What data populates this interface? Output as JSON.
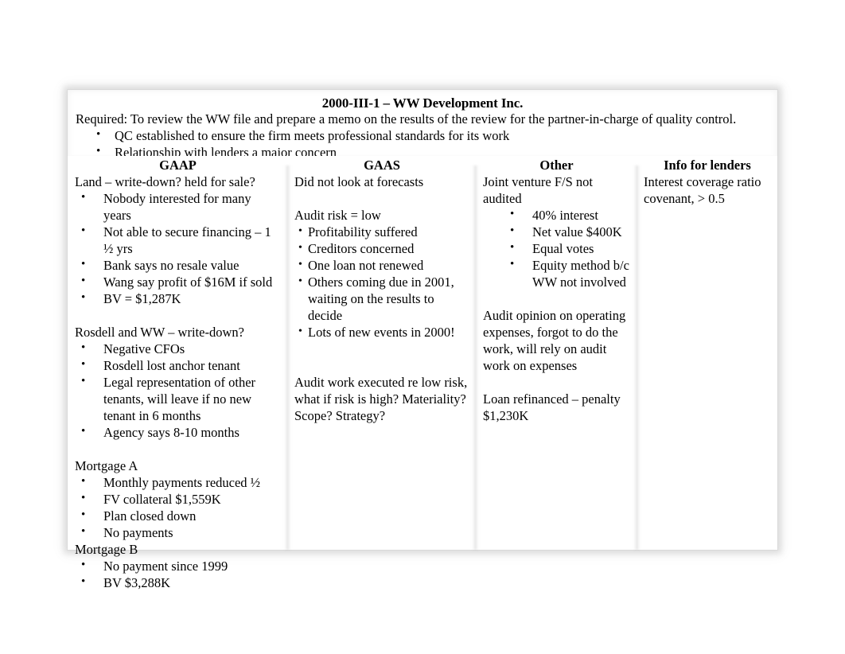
{
  "document": {
    "title": "2000-III-1 – WW Development Inc.",
    "required_line": "Required: To review the WW file and prepare a memo on the results of the review for the partner-in-charge of quality control.",
    "header_bullets": [
      "QC established to ensure the firm meets professional standards for its work",
      "Relationship with lenders a major concern"
    ]
  },
  "table": {
    "columns": [
      {
        "header": "GAAP",
        "blocks": [
          {
            "kind": "text",
            "text": "Land – write-down? held for sale?"
          },
          {
            "kind": "bullets",
            "style": "wide",
            "items": [
              "Nobody interested for many years",
              "Not able to secure financing – 1 ½ yrs",
              "Bank says no resale value",
              "Wang say profit of $16M if sold",
              "BV = $1,287K"
            ]
          },
          {
            "kind": "spacer"
          },
          {
            "kind": "text",
            "text": "Rosdell and WW – write-down?"
          },
          {
            "kind": "bullets",
            "style": "wide",
            "items": [
              "Negative CFOs",
              "Rosdell lost anchor tenant",
              "Legal representation of other tenants, will leave if no new tenant in 6 months",
              "Agency says 8-10 months"
            ]
          },
          {
            "kind": "spacer"
          },
          {
            "kind": "text",
            "text": "Mortgage A"
          },
          {
            "kind": "bullets",
            "style": "wide",
            "items": [
              "Monthly payments reduced ½",
              "FV collateral $1,559K",
              "Plan closed down",
              "No payments"
            ]
          },
          {
            "kind": "text",
            "text": "Mortgage B"
          },
          {
            "kind": "bullets",
            "style": "wide",
            "items": [
              "No payment since 1999",
              "BV $3,288K"
            ]
          }
        ]
      },
      {
        "header": "GAAS",
        "blocks": [
          {
            "kind": "text",
            "text": "Did not look at forecasts"
          },
          {
            "kind": "spacer"
          },
          {
            "kind": "text",
            "text": "Audit risk = low"
          },
          {
            "kind": "bullets",
            "style": "tight",
            "items": [
              "Profitability suffered",
              "Creditors concerned",
              "One loan not renewed",
              "Others coming due in 2001, waiting on the results to decide",
              "Lots of new events in 2000!"
            ]
          },
          {
            "kind": "spacer"
          },
          {
            "kind": "spacer"
          },
          {
            "kind": "text",
            "text": "Audit work executed re low risk, what if risk is high?  Materiality? Scope? Strategy?"
          }
        ]
      },
      {
        "header": "Other",
        "blocks": [
          {
            "kind": "text",
            "text": "Joint venture F/S not audited"
          },
          {
            "kind": "bullets",
            "style": "deep",
            "items": [
              "40% interest",
              "Net value $400K",
              "Equal votes",
              "Equity method b/c WW not involved"
            ]
          },
          {
            "kind": "spacer"
          },
          {
            "kind": "text",
            "text": "Audit opinion on operating expenses, forgot to do the work, will rely on audit work on expenses"
          },
          {
            "kind": "spacer"
          },
          {
            "kind": "text",
            "text": "Loan refinanced – penalty $1,230K"
          }
        ]
      },
      {
        "header": "Info for lenders",
        "blocks": [
          {
            "kind": "text",
            "text": "Interest coverage ratio covenant, > 0.5"
          }
        ]
      }
    ]
  }
}
